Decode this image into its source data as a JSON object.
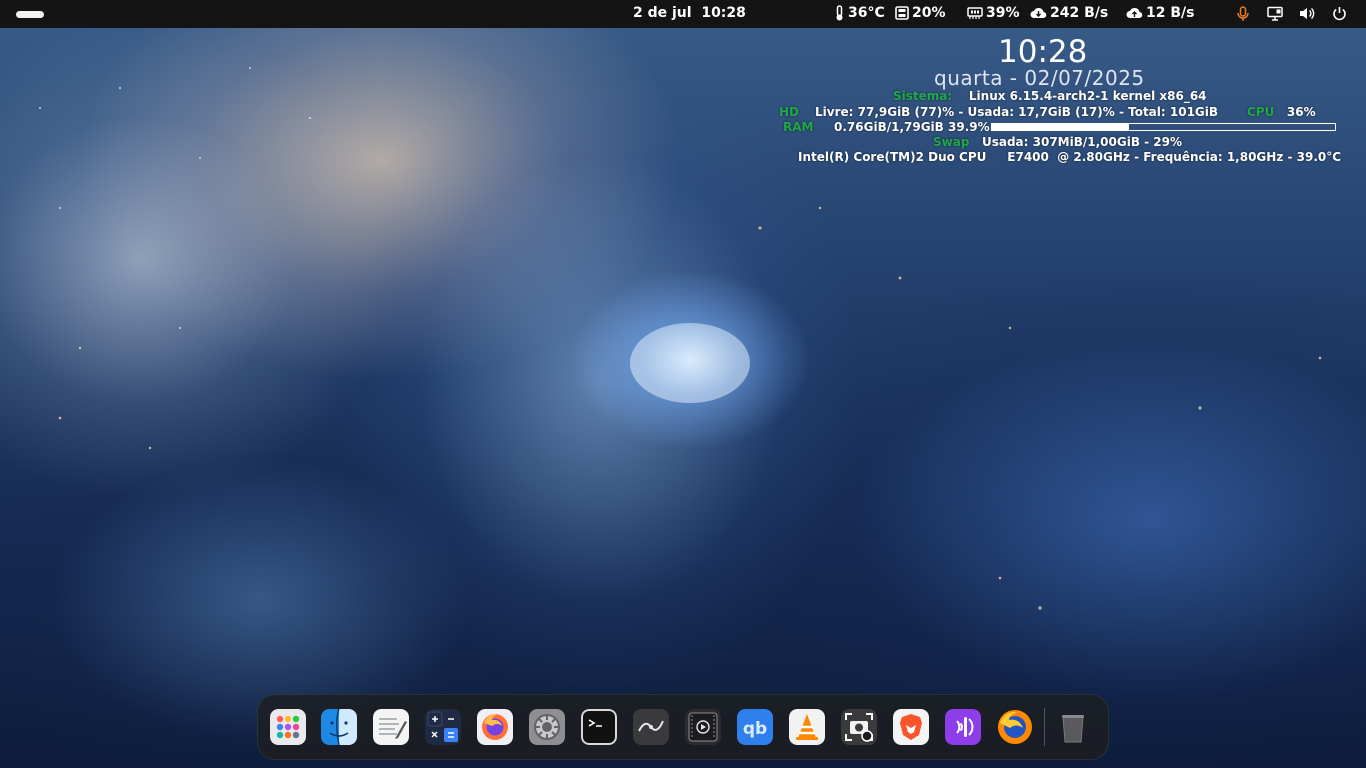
{
  "topbar": {
    "date": "2 de jul",
    "time": "10:28",
    "temperature": "36°C",
    "disk": "20%",
    "memory": "39%",
    "download": "242 B/s",
    "upload": "12 B/s",
    "icons": [
      "activities-indicator",
      "thermometer-icon",
      "disk-icon",
      "memory-icon",
      "download-cloud-icon",
      "upload-cloud-icon",
      "microphone-icon",
      "screen-share-icon",
      "volume-icon",
      "power-icon"
    ]
  },
  "conky": {
    "time": "10:28",
    "date": "quarta - 02/07/2025",
    "sistema_label": "Sistema:",
    "sistema_value": "Linux 6.15.4-arch2-1 kernel x86_64",
    "hd_label": "HD",
    "hd_value": "Livre: 77,9GiB (77)% - Usada: 17,7GiB (17)% - Total: 101GiB",
    "cpu_label": "CPU",
    "cpu_value": "36%",
    "ram_label": "RAM",
    "ram_value": "0.76GiB/1,79GiB 39.9%",
    "ram_fraction": 0.399,
    "swap_label": "Swap",
    "swap_value": "Usada: 307MiB/1,00GiB - 29%",
    "cpu_model": "Intel(R) Core(TM)2 Duo CPU     E7400  @ 2.80GHz - Frequência: 1,80GHz - 39.0°C",
    "label_color": "#1fa84a"
  },
  "dock": {
    "apps": [
      "app-grid",
      "finder",
      "text-editor",
      "calculator",
      "firefox",
      "settings",
      "terminal",
      "inkscape",
      "video-player",
      "qbittorrent",
      "vlc",
      "screenshot",
      "brave",
      "podcast",
      "firefox-nightly",
      "trash"
    ]
  }
}
